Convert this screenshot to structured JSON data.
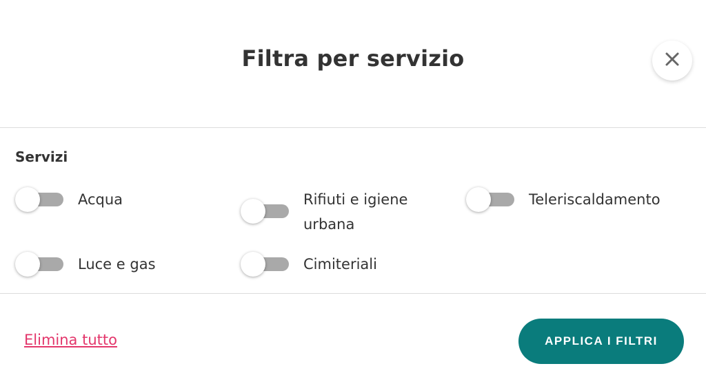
{
  "modal": {
    "title": "Filtra per servizio"
  },
  "section": {
    "label": "Servizi"
  },
  "options": [
    {
      "label_line1": "Acqua",
      "label_line2": "",
      "checked": false
    },
    {
      "label_line1": "Rifiuti e igiene",
      "label_line2": "urbana",
      "checked": false
    },
    {
      "label_line1": "Teleriscaldamento",
      "label_line2": "",
      "checked": false
    },
    {
      "label_line1": "Luce e gas",
      "label_line2": "",
      "checked": false
    },
    {
      "label_line1": "Cimiteriali",
      "label_line2": "",
      "checked": false
    }
  ],
  "footer": {
    "clear_label": "Elimina tutto",
    "apply_label": "APPLICA I FILTRI"
  },
  "colors": {
    "accent": "#0a7c7c",
    "link": "#e3366b",
    "toggle_off": "#a9a9a9",
    "text": "#333333"
  },
  "icons": {
    "close": "close-icon"
  }
}
